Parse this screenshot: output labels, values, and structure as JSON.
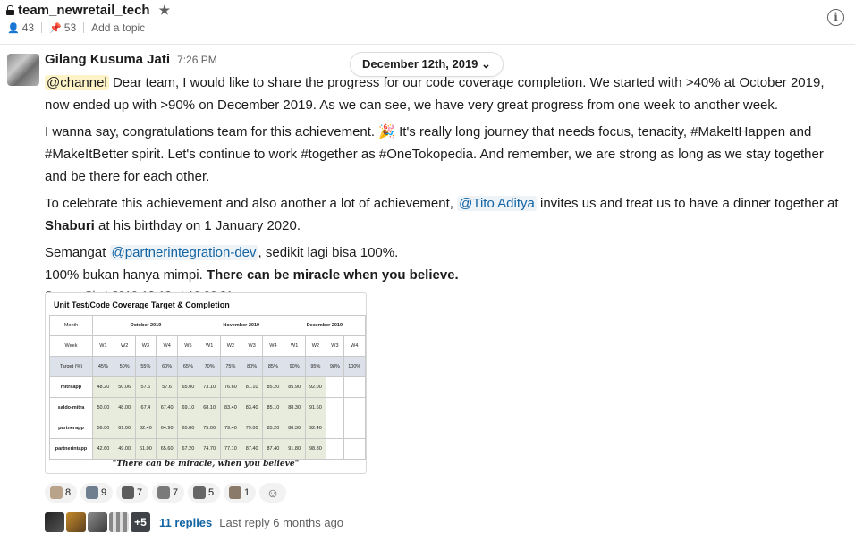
{
  "channel": {
    "name": "team_newretail_tech",
    "members": "43",
    "pins": "53",
    "topic_placeholder": "Add a topic"
  },
  "date_divider": "December 12th, 2019",
  "message": {
    "author": "Gilang Kusuma Jati",
    "time": "7:26 PM",
    "p1_mention": "@channel",
    "p1": " Dear team, I would like to share the progress for our code coverage completion. We started with >40% at October 2019, now ended up with >90% on December 2019. As we can see, we have very great progress from one week to another week.",
    "p2a": "I wanna say, congratulations team for this achievement. ",
    "p2_emoji": "🎉",
    "p2b": " It's really long journey that needs focus, tenacity, #MakeItHappen and #MakeItBetter spirit. Let's continue to work #together as #OneTokopedia. And remember, we are strong as long as we stay together and be there for each other.",
    "p3a": "To celebrate this achievement and also another a lot of achievement, ",
    "p3_mention": "@Tito Aditya",
    "p3b": " invites us and treat us to have a dinner together at ",
    "p3_bold": "Shaburi",
    "p3c": " at his birthday on 1 January 2020.",
    "p4a": "Semangat ",
    "p4_mention": "@partnerintegration-dev",
    "p4b": ", sedikit lagi bisa 100%.",
    "p5a": "100% bukan hanya mimpi. ",
    "p5_bold": "There can be miracle when you believe."
  },
  "attachment": {
    "file_name": "Screen Shot 2019-12-12 at 19.06.21.png",
    "title": "Unit Test/Code Coverage Target & Completion",
    "month_label": "Month",
    "week_label": "Week",
    "months": [
      "October 2019",
      "November 2019",
      "December 2019"
    ],
    "weeks": [
      "W1",
      "W2",
      "W3",
      "W4",
      "W5",
      "W1",
      "W2",
      "W3",
      "W4",
      "W1",
      "W2",
      "W3",
      "W4"
    ],
    "target_label": "Target (%)",
    "targets": [
      "45%",
      "50%",
      "55%",
      "60%",
      "65%",
      "70%",
      "75%",
      "80%",
      "85%",
      "90%",
      "95%",
      "98%",
      "100%"
    ],
    "rows": [
      {
        "name": "mitraapp",
        "values": [
          "48.20",
          "50.06",
          "57.6",
          "57.6",
          "65.00",
          "73.10",
          "76.60",
          "81.10",
          "85.20",
          "85.90",
          "92.00",
          "",
          ""
        ]
      },
      {
        "name": "saldo-mitra",
        "values": [
          "50.00",
          "48.00",
          "67.4",
          "67.40",
          "69.10",
          "68.10",
          "83.40",
          "83.40",
          "85.10",
          "88.30",
          "91.60",
          "",
          ""
        ]
      },
      {
        "name": "partnerapp",
        "values": [
          "56.00",
          "61.00",
          "62.40",
          "64.90",
          "65.80",
          "75.00",
          "79.40",
          "79.00",
          "85.20",
          "88.30",
          "92.40",
          "",
          ""
        ]
      },
      {
        "name": "partnerintapp",
        "values": [
          "42.60",
          "49.00",
          "61.00",
          "65.60",
          "67.20",
          "74.70",
          "77.10",
          "87.40",
          "87.40",
          "91.80",
          "98.80",
          "",
          ""
        ]
      }
    ],
    "caption": "\"There can be miracle, when you believe\""
  },
  "reactions": [
    {
      "name": "reaction-1",
      "count": "8"
    },
    {
      "name": "reaction-2",
      "count": "9"
    },
    {
      "name": "reaction-3",
      "count": "7"
    },
    {
      "name": "reaction-4",
      "count": "7"
    },
    {
      "name": "reaction-5",
      "count": "5"
    },
    {
      "name": "reaction-6",
      "count": "1"
    }
  ],
  "thread": {
    "more": "+5",
    "replies": "11 replies",
    "last_reply": "Last reply 6 months ago"
  }
}
